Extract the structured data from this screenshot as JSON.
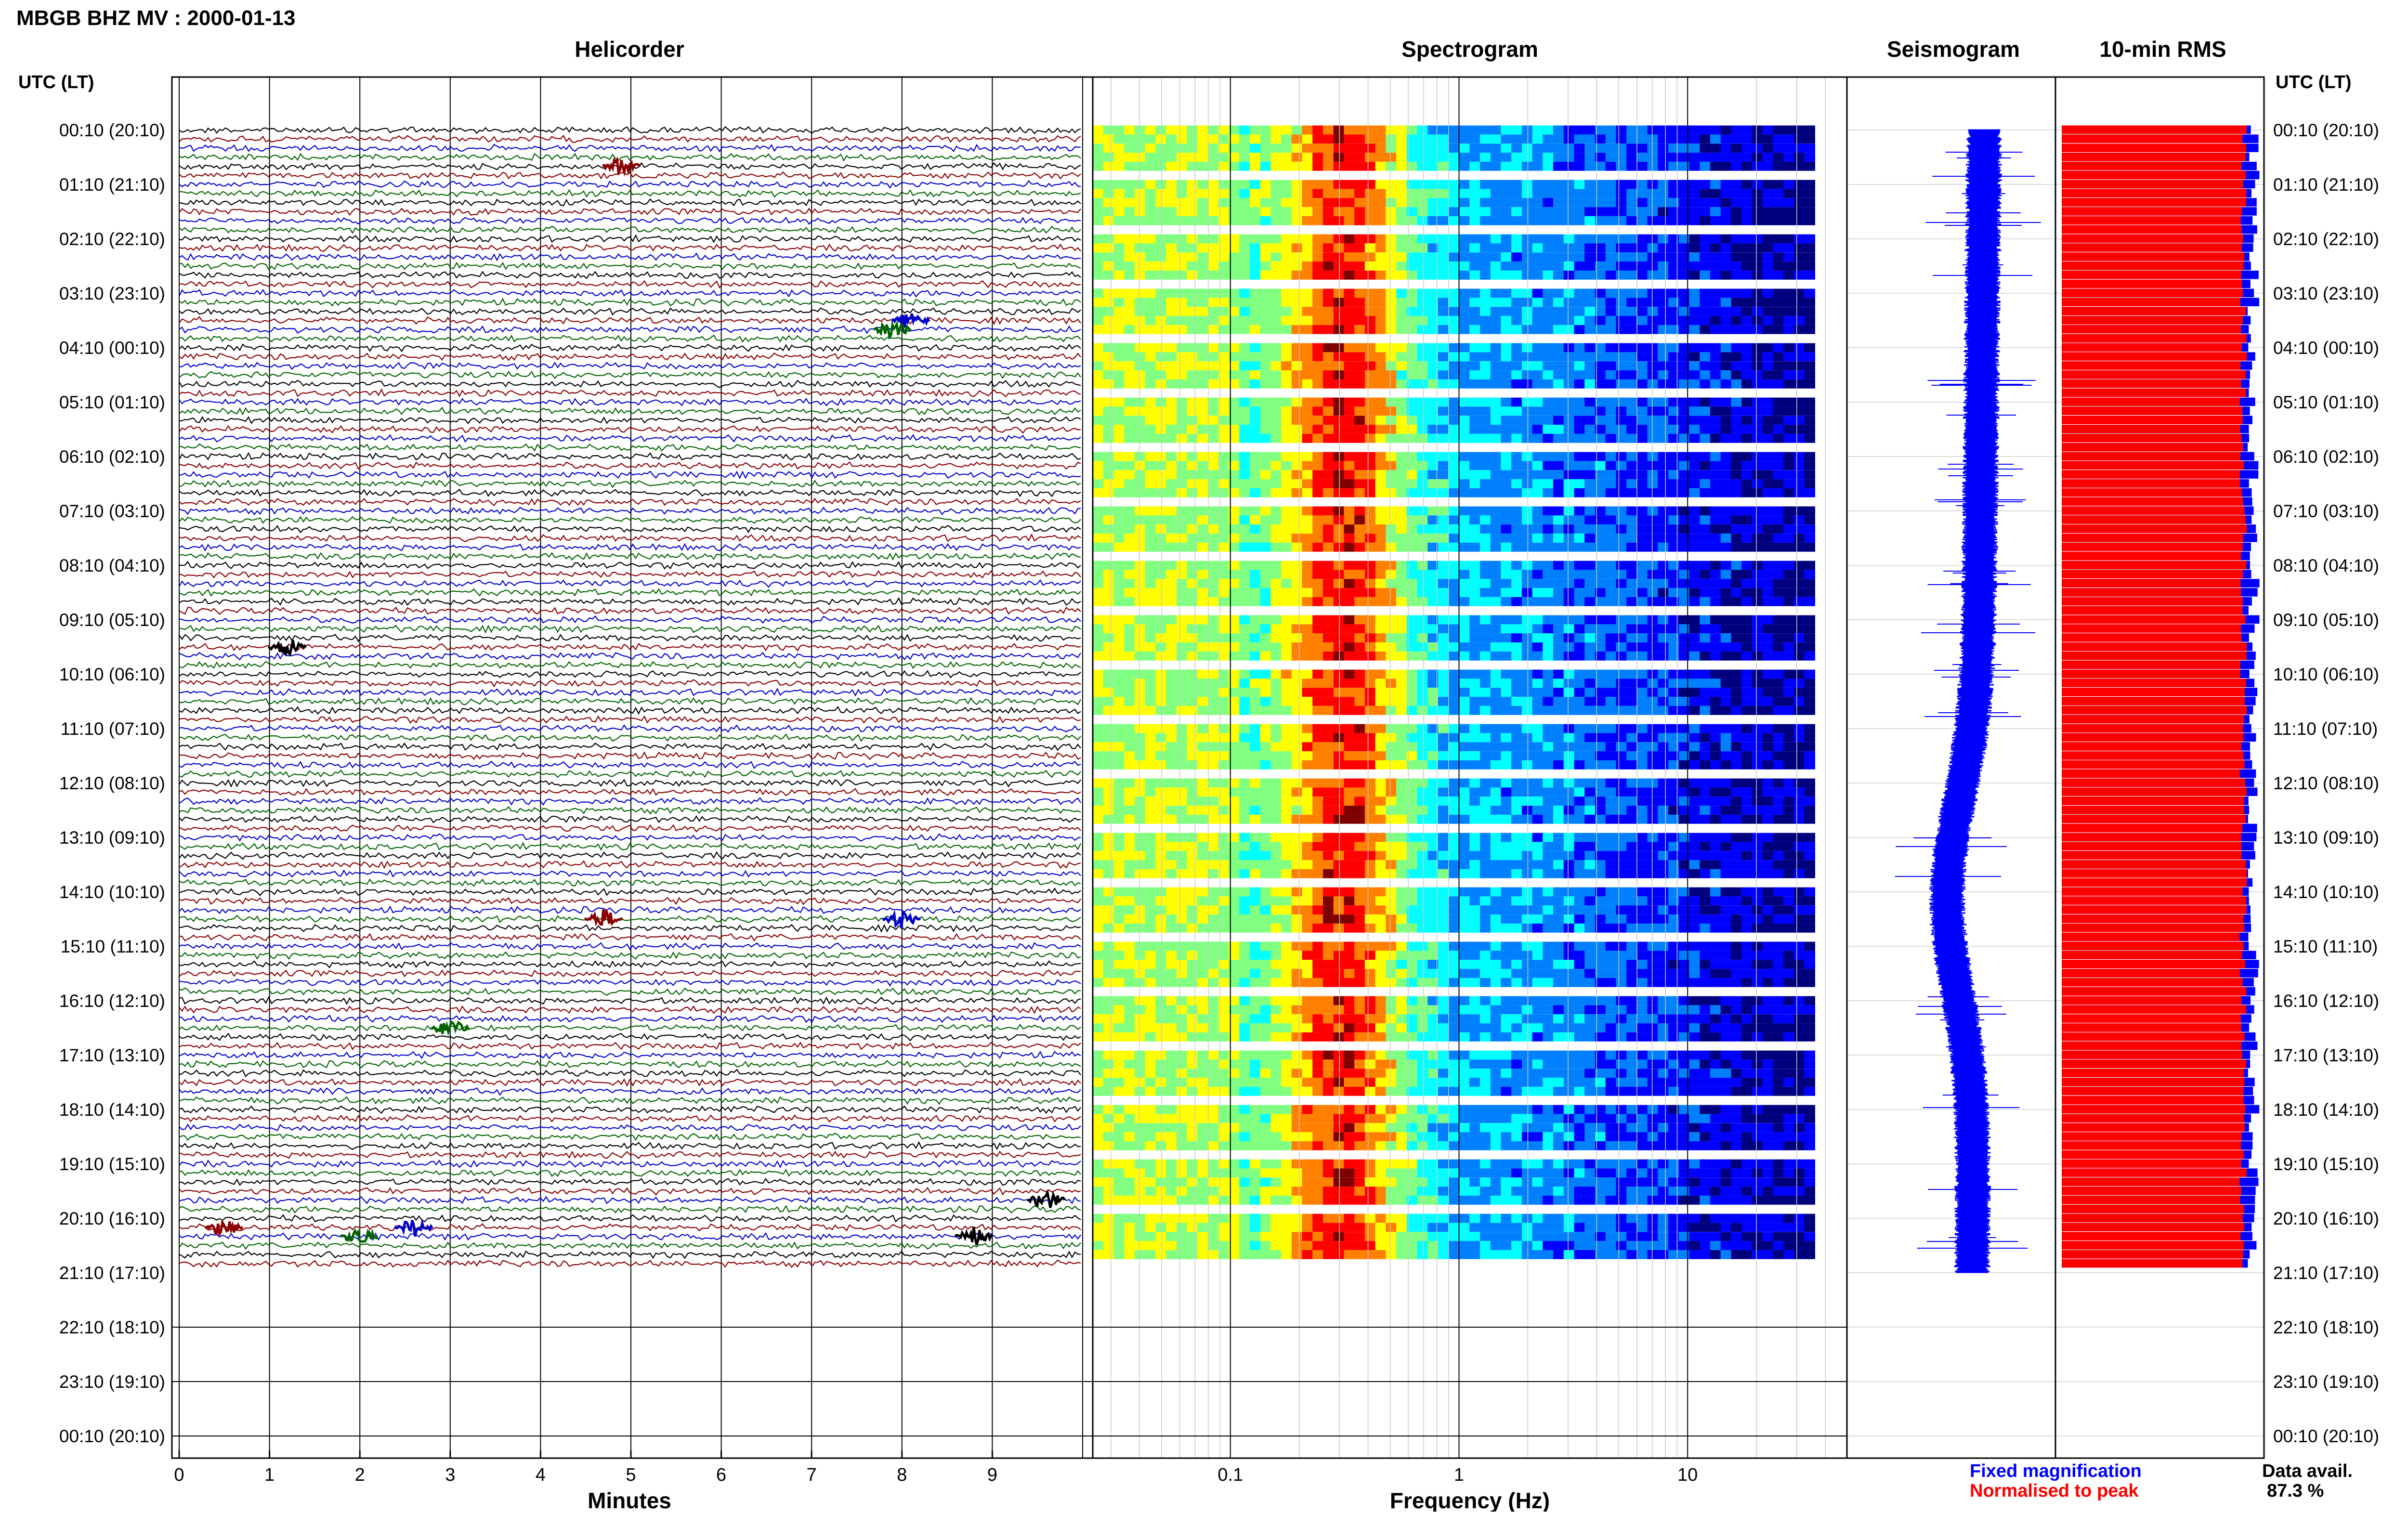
{
  "title": "MBGB BHZ MV : 2000-01-13",
  "panels": {
    "helicorder": "Helicorder",
    "spectrogram": "Spectrogram",
    "seismogram": "Seismogram",
    "rms": "10-min RMS"
  },
  "time_header": "UTC (LT)",
  "time_labels": [
    "00:10 (20:10)",
    "01:10 (21:10)",
    "02:10 (22:10)",
    "03:10 (23:10)",
    "04:10 (00:10)",
    "05:10 (01:10)",
    "06:10 (02:10)",
    "07:10 (03:10)",
    "08:10 (04:10)",
    "09:10 (05:10)",
    "10:10 (06:10)",
    "11:10 (07:10)",
    "12:10 (08:10)",
    "13:10 (09:10)",
    "14:10 (10:10)",
    "15:10 (11:10)",
    "16:10 (12:10)",
    "17:10 (13:10)",
    "18:10 (14:10)",
    "19:10 (15:10)",
    "20:10 (16:10)",
    "21:10 (17:10)",
    "22:10 (18:10)",
    "23:10 (19:10)",
    "00:10 (20:10)"
  ],
  "helicorder_xlabel": "Minutes",
  "minute_ticks": [
    "0",
    "1",
    "2",
    "3",
    "4",
    "5",
    "6",
    "7",
    "8",
    "9"
  ],
  "spectrogram_xlabel": "Frequency (Hz)",
  "freq_ticks": [
    "0.1",
    "1",
    "10"
  ],
  "legend": {
    "fixed": "Fixed magnification",
    "normalised": "Normalised to peak",
    "fixed_color": "#0000ff",
    "normalised_color": "#ff0000"
  },
  "availability": {
    "label": "Data avail.",
    "value": "87.3 %"
  },
  "trace_colors": [
    "#000000",
    "#8b0000",
    "#0000cd",
    "#006400"
  ],
  "chart_data": {
    "type": "helicorder",
    "rows": 126,
    "row_minutes": 10,
    "helicorder_xlim": [
      0,
      10
    ],
    "spectrogram_freq_range": [
      0.025,
      40
    ],
    "spectrogram_scale": "log",
    "colormap": [
      "#00007f",
      "#0000ff",
      "#0080ff",
      "#00ffff",
      "#80ff80",
      "#ffff00",
      "#ff8000",
      "#ff0000",
      "#7f0000"
    ],
    "rms_normalised_fraction": 0.955,
    "events": [
      {
        "time": "00:50",
        "minute": 4.9
      },
      {
        "time": "03:40",
        "minute": 8.1
      },
      {
        "time": "03:50",
        "minute": 7.9
      },
      {
        "time": "09:40",
        "minute": 1.2
      },
      {
        "time": "14:40",
        "minute": 4.7
      },
      {
        "time": "14:40",
        "minute": 8.0
      },
      {
        "time": "16:40",
        "minute": 3.0
      },
      {
        "time": "19:50",
        "minute": 9.6
      },
      {
        "time": "20:20",
        "minute": 0.5
      },
      {
        "time": "20:20",
        "minute": 2.6
      },
      {
        "time": "20:30",
        "minute": 2.0
      },
      {
        "time": "20:30",
        "minute": 8.8
      }
    ]
  }
}
